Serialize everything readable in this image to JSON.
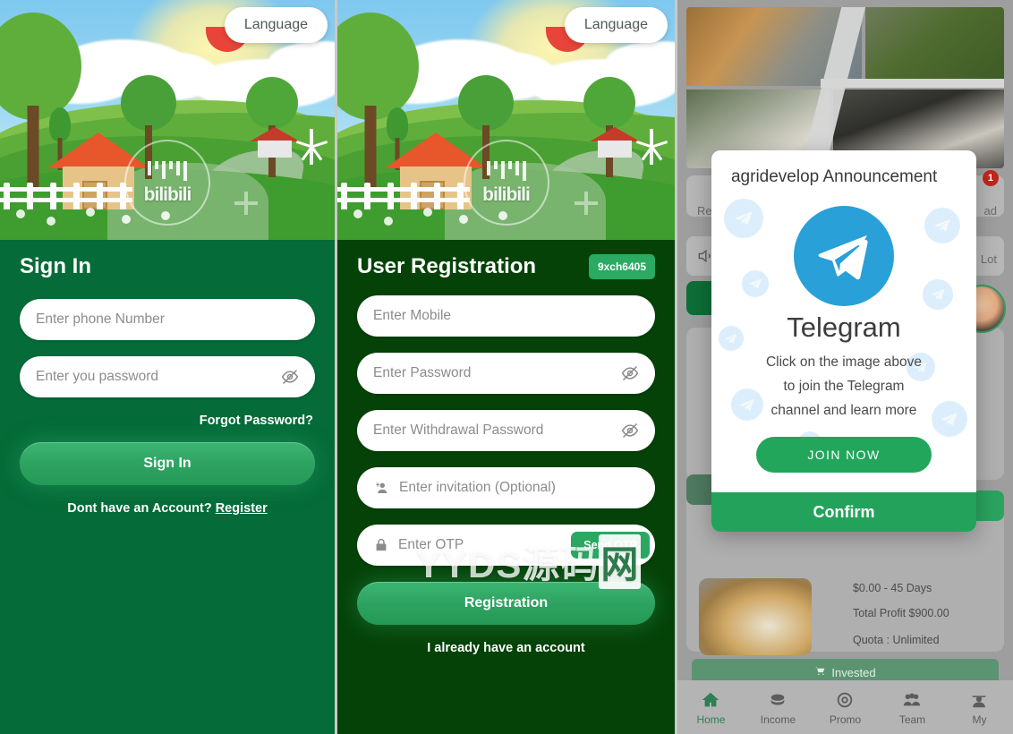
{
  "signin": {
    "language_button": "Language",
    "title": "Sign In",
    "phone_placeholder": "Enter phone Number",
    "password_placeholder": "Enter you password",
    "forgot_password": "Forgot Password?",
    "submit_label": "Sign In",
    "register_prompt": "Dont have an Account?",
    "register_link": "Register",
    "logo_watermark": "bilibili"
  },
  "registration": {
    "language_button": "Language",
    "title": "User Registration",
    "code_badge": "9xch6405",
    "mobile_placeholder": "Enter Mobile",
    "password_placeholder": "Enter Password",
    "withdrawal_password_placeholder": "Enter Withdrawal Password",
    "invitation_placeholder": "Enter invitation (Optional)",
    "otp_placeholder": "Enter OTP",
    "send_otp_label": "Send OTP",
    "submit_label": "Registration",
    "existing_account": "I already have an account",
    "logo_watermark": "bilibili"
  },
  "home": {
    "notification_count": "1",
    "record_label": "Re",
    "download_label": "ad",
    "lot_label": "Lot",
    "product": {
      "price_days": "$0.00 - 45 Days",
      "total_profit": "Total Profit $900.00",
      "quota": "Quota : Unlimited",
      "invested_label": "Invested"
    },
    "tabs": [
      {
        "label": "Home",
        "icon": "home-icon",
        "active": true
      },
      {
        "label": "Income",
        "icon": "income-icon",
        "active": false
      },
      {
        "label": "Promo",
        "icon": "promo-icon",
        "active": false
      },
      {
        "label": "Team",
        "icon": "team-icon",
        "active": false
      },
      {
        "label": "My",
        "icon": "user-icon",
        "active": false
      }
    ]
  },
  "modal": {
    "title": "agridevelop Announcement",
    "brand": "Telegram",
    "description_line1": "Click on the image above",
    "description_line2": "to join the Telegram",
    "description_line3": "channel and learn more",
    "join_label": "JOIN NOW",
    "confirm_label": "Confirm"
  },
  "watermark": {
    "latin": "YYDS",
    "cn": "源码",
    "boxed": "网"
  },
  "colors": {
    "signin_bg": "#056b38",
    "registration_bg": "#054208",
    "cta_green": "#2fa462",
    "badge_green": "#2aaa63",
    "telegram_blue": "#29a0d8",
    "confirm_green": "#23a25b",
    "notification_red": "#c2261b"
  }
}
